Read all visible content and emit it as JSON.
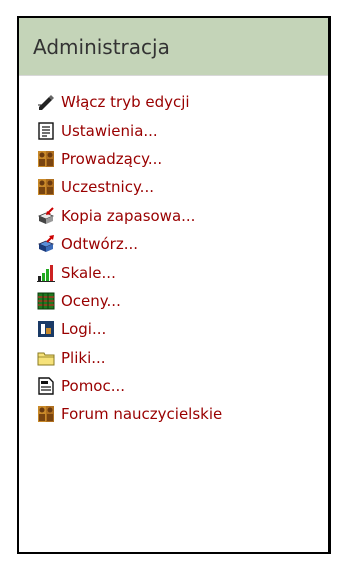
{
  "block": {
    "title": "Administracja"
  },
  "menu": {
    "items": [
      {
        "label": "Włącz tryb edycji",
        "icon": "edit-pencil-icon"
      },
      {
        "label": "Ustawienia...",
        "icon": "settings-document-icon"
      },
      {
        "label": "Prowadzący...",
        "icon": "teachers-icon"
      },
      {
        "label": "Uczestnicy...",
        "icon": "students-icon"
      },
      {
        "label": "Kopia zapasowa...",
        "icon": "backup-icon"
      },
      {
        "label": "Odtwórz...",
        "icon": "restore-icon"
      },
      {
        "label": "Skale...",
        "icon": "scales-icon"
      },
      {
        "label": "Oceny...",
        "icon": "grades-icon"
      },
      {
        "label": "Logi...",
        "icon": "logs-icon"
      },
      {
        "label": "Pliki...",
        "icon": "folder-icon"
      },
      {
        "label": "Pomoc...",
        "icon": "help-document-icon"
      },
      {
        "label": "Forum nauczycielskie",
        "icon": "teacher-forum-icon"
      }
    ]
  },
  "colors": {
    "header_bg": "#c4d4b8",
    "link": "#990000",
    "border": "#000000"
  }
}
